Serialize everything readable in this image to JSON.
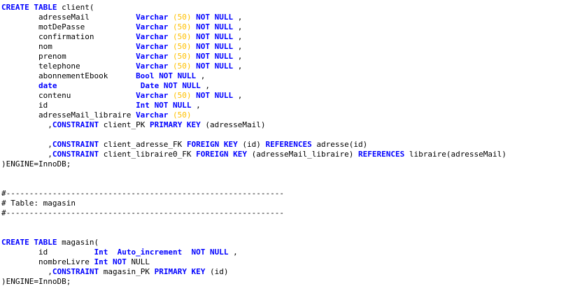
{
  "editor": {
    "colors": {
      "background": "#ffffff",
      "text": "#000000",
      "keyword": "#0000ff",
      "number": "#ffc000",
      "comment": "#000000"
    },
    "lines": [
      [
        [
          "CREATE TABLE",
          "kw"
        ],
        [
          " client(",
          ""
        ]
      ],
      [
        [
          "        adresseMail          ",
          ""
        ],
        [
          "Varchar",
          "kw"
        ],
        [
          " ",
          ""
        ],
        [
          "(50)",
          "num"
        ],
        [
          " ",
          ""
        ],
        [
          "NOT NULL",
          "kw"
        ],
        [
          " ,",
          ""
        ]
      ],
      [
        [
          "        motDePasse           ",
          ""
        ],
        [
          "Varchar",
          "kw"
        ],
        [
          " ",
          ""
        ],
        [
          "(50)",
          "num"
        ],
        [
          " ",
          ""
        ],
        [
          "NOT NULL",
          "kw"
        ],
        [
          " ,",
          ""
        ]
      ],
      [
        [
          "        confirmation         ",
          ""
        ],
        [
          "Varchar",
          "kw"
        ],
        [
          " ",
          ""
        ],
        [
          "(50)",
          "num"
        ],
        [
          " ",
          ""
        ],
        [
          "NOT NULL",
          "kw"
        ],
        [
          " ,",
          ""
        ]
      ],
      [
        [
          "        nom                  ",
          ""
        ],
        [
          "Varchar",
          "kw"
        ],
        [
          " ",
          ""
        ],
        [
          "(50)",
          "num"
        ],
        [
          " ",
          ""
        ],
        [
          "NOT NULL",
          "kw"
        ],
        [
          " ,",
          ""
        ]
      ],
      [
        [
          "        prenom               ",
          ""
        ],
        [
          "Varchar",
          "kw"
        ],
        [
          " ",
          ""
        ],
        [
          "(50)",
          "num"
        ],
        [
          " ",
          ""
        ],
        [
          "NOT NULL",
          "kw"
        ],
        [
          " ,",
          ""
        ]
      ],
      [
        [
          "        telephone            ",
          ""
        ],
        [
          "Varchar",
          "kw"
        ],
        [
          " ",
          ""
        ],
        [
          "(50)",
          "num"
        ],
        [
          " ",
          ""
        ],
        [
          "NOT NULL",
          "kw"
        ],
        [
          " ,",
          ""
        ]
      ],
      [
        [
          "        abonnementEbook      ",
          ""
        ],
        [
          "Bool",
          "kw"
        ],
        [
          " ",
          ""
        ],
        [
          "NOT NULL",
          "kw"
        ],
        [
          " ,",
          ""
        ]
      ],
      [
        [
          "        ",
          ""
        ],
        [
          "date",
          "kw"
        ],
        [
          "                  ",
          ""
        ],
        [
          "Date",
          "kw"
        ],
        [
          " ",
          ""
        ],
        [
          "NOT NULL",
          "kw"
        ],
        [
          " ,",
          ""
        ]
      ],
      [
        [
          "        contenu              ",
          ""
        ],
        [
          "Varchar",
          "kw"
        ],
        [
          " ",
          ""
        ],
        [
          "(50)",
          "num"
        ],
        [
          " ",
          ""
        ],
        [
          "NOT NULL",
          "kw"
        ],
        [
          " ,",
          ""
        ]
      ],
      [
        [
          "        id                   ",
          ""
        ],
        [
          "Int",
          "kw"
        ],
        [
          " ",
          ""
        ],
        [
          "NOT NULL",
          "kw"
        ],
        [
          " ,",
          ""
        ]
      ],
      [
        [
          "        adresseMail_libraire ",
          ""
        ],
        [
          "Varchar",
          "kw"
        ],
        [
          " ",
          ""
        ],
        [
          "(50)",
          "num"
        ]
      ],
      [
        [
          "          ,",
          ""
        ],
        [
          "CONSTRAINT",
          "kw"
        ],
        [
          " client_PK ",
          ""
        ],
        [
          "PRIMARY KEY",
          "kw"
        ],
        [
          " (adresseMail)",
          ""
        ]
      ],
      [
        [
          "",
          ""
        ]
      ],
      [
        [
          "          ,",
          ""
        ],
        [
          "CONSTRAINT",
          "kw"
        ],
        [
          " client_adresse_FK ",
          ""
        ],
        [
          "FOREIGN KEY",
          "kw"
        ],
        [
          " (id) ",
          ""
        ],
        [
          "REFERENCES",
          "kw"
        ],
        [
          " adresse(id)",
          ""
        ]
      ],
      [
        [
          "          ,",
          ""
        ],
        [
          "CONSTRAINT",
          "kw"
        ],
        [
          " client_libraire0_FK ",
          ""
        ],
        [
          "FOREIGN KEY",
          "kw"
        ],
        [
          " (adresseMail_libraire) ",
          ""
        ],
        [
          "REFERENCES",
          "kw"
        ],
        [
          " libraire(adresseMail)",
          ""
        ]
      ],
      [
        [
          ")ENGINE=InnoDB;",
          ""
        ]
      ],
      [
        [
          "",
          ""
        ]
      ],
      [
        [
          "",
          ""
        ]
      ],
      [
        [
          "#------------------------------------------------------------",
          "cm"
        ]
      ],
      [
        [
          "# Table: magasin",
          "cm"
        ]
      ],
      [
        [
          "#------------------------------------------------------------",
          "cm"
        ]
      ],
      [
        [
          "",
          ""
        ]
      ],
      [
        [
          "",
          ""
        ]
      ],
      [
        [
          "CREATE TABLE",
          "kw"
        ],
        [
          " magasin(",
          ""
        ]
      ],
      [
        [
          "        id          ",
          ""
        ],
        [
          "Int",
          "kw"
        ],
        [
          "  ",
          ""
        ],
        [
          "Auto_increment",
          "kw"
        ],
        [
          "  ",
          ""
        ],
        [
          "NOT NULL",
          "kw"
        ],
        [
          " ,",
          ""
        ]
      ],
      [
        [
          "        nombreLivre ",
          ""
        ],
        [
          "Int",
          "kw"
        ],
        [
          " ",
          ""
        ],
        [
          "NOT",
          "kw"
        ],
        [
          " NULL",
          ""
        ]
      ],
      [
        [
          "          ,",
          ""
        ],
        [
          "CONSTRAINT",
          "kw"
        ],
        [
          " magasin_PK ",
          ""
        ],
        [
          "PRIMARY KEY",
          "kw"
        ],
        [
          " (id)",
          ""
        ]
      ],
      [
        [
          ")ENGINE=InnoDB;",
          ""
        ]
      ]
    ]
  }
}
